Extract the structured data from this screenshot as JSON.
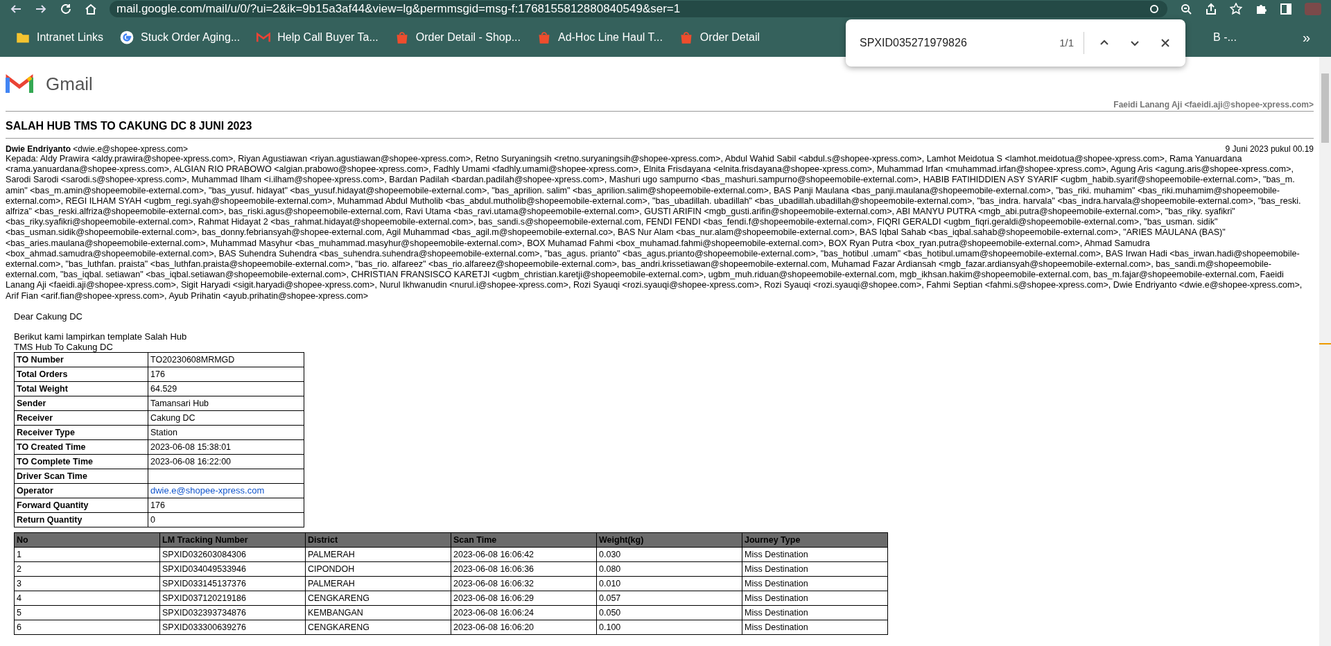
{
  "browser": {
    "url": "mail.google.com/mail/u/0/?ui=2&ik=9b15a3af44&view=lg&permmsgid=msg-f:1768155812880840549&ser=1",
    "bookmarks": [
      {
        "kind": "folder",
        "label": "Intranet Links"
      },
      {
        "kind": "google",
        "label": "Stuck Order Aging..."
      },
      {
        "kind": "gmail",
        "label": "Help Call Buyer Ta..."
      },
      {
        "kind": "shop",
        "label": "Order Detail - Shop..."
      },
      {
        "kind": "shop",
        "label": "Ad-Hoc Line Haul T..."
      },
      {
        "kind": "shop",
        "label": "Order Detail"
      },
      {
        "kind": "none",
        "label": "B -..."
      }
    ],
    "more": "»",
    "find_bar": {
      "query": "SPXID035271979826",
      "count": "1/1"
    }
  },
  "gmail": {
    "logo": "Gmail",
    "account": "Faeidi Lanang Aji <faeidi.aji@shopee-xpress.com>"
  },
  "email": {
    "subject": "SALAH HUB TMS TO CAKUNG DC 8 JUNI 2023",
    "sender_name": "Dwie Endriyanto",
    "sender_email": "<dwie.e@shopee-xpress.com>",
    "date": "9 Juni 2023 pukul 00.19",
    "recipients": "Kepada: Aldy Prawira <aldy.prawira@shopee-xpress.com>, Riyan Agustiawan <riyan.agustiawan@shopee-xpress.com>, Retno Suryaningsih <retno.suryaningsih@shopee-xpress.com>, Abdul Wahid Sabil <abdul.s@shopee-xpress.com>, Lamhot Meidotua S <lamhot.meidotua@shopee-xpress.com>, Rama Yanuardana <rama.yanuardana@shopee-xpress.com>, ALGIAN RIO PRABOWO <algian.prabowo@shopee-xpress.com>, Fadhly Umami <fadhly.umami@shopee-xpress.com>, Elnita Frisdayana <elnita.frisdayana@shopee-xpress.com>, Muhammad Irfan <muhammad.irfan@shopee-xpress.com>, Agung Aris <agung.aris@shopee-xpress.com>, Sarodi Sarodi <sarodi.s@shopee-xpress.com>, Muhammad Ilham <i.ilham@shopee-xpress.com>, Bardan Padilah <bardan.padilah@shopee-xpress.com>, Mashuri ugo sampurno <bas_mashuri.sampurno@shopeemobile-external.com>, HABIB FATIHIDDIEN ASY SYARIF <ugbm_habib.syarif@shopeemobile-external.com>, \"bas_m. amin\" <bas_m.amin@shopeemobile-external.com>, \"bas_yusuf. hidayat\" <bas_yusuf.hidayat@shopeemobile-external.com>, \"bas_aprilion. salim\" <bas_aprilion.salim@shopeemobile-external.com>, BAS Panji Maulana <bas_panji.maulana@shopeemobile-external.com>, \"bas_riki. muhamim\" <bas_riki.muhamim@shopeemobile-external.com>, REGI ILHAM SYAH <ugbm_regi.syah@shopeemobile-external.com>, Muhammad Abdul Mutholib <bas_abdul.mutholib@shopeemobile-external.com>, \"bas_ubadillah. ubadillah\" <bas_ubadillah.ubadillah@shopeemobile-external.com>, \"bas_indra. harvala\" <bas_indra.harvala@shopeemobile-external.com>, \"bas_reski. alfriza\" <bas_reski.alfriza@shopeemobile-external.com>, bas_riski.agus@shopeemobile-external.com, Ravi Utama <bas_ravi.utama@shopeemobile-external.com>, GUSTI ARIFIN <mgb_gusti.arifin@shopeemobile-external.com>, ABI MANYU PUTRA <mgb_abi.putra@shopeemobile-external.com>, \"bas_riky. syafikri\" <bas_riky.syafikri@shopeemobile-external.com>, Rahmat Hidayat 2 <bas_rahmat.hidayat@shopeemobile-external.com>, bas_sandi.s@shopeemobile-external.com, FENDI FENDI <bas_fendi.f@shopeemobile-external.com>, FIQRI GERALDI <ugbm_fiqri.geraldi@shopeemobile-external.com>, \"bas_usman. sidik\" <bas_usman.sidik@shopeemobile-external.com>, bas_donny.febriansyah@shopee-external.com, Agil Muhammad <bas_agil.m@shopeemobile-external.co>, BAS Nur Alam <bas_nur.alam@shopeemobile-external.com>, BAS Iqbal Sahab <bas_iqbal.sahab@shopeemobile-external.com>, \"ARIES MAULANA (BAS)\" <bas_aries.maulana@shopeemobile-external.com>, Muhammad Masyhur <bas_muhammad.masyhur@shopeemobile-external.com>, BOX Muhamad Fahmi <box_muhamad.fahmi@shopeemobile-external.com>, BOX Ryan Putra <box_ryan.putra@shopeemobile-external.com>, Ahmad Samudra <box_ahmad.samudra@shopeemobile-external.com>, BAS Suhendra Suhendra <bas_suhendra.suhendra@shopeemobile-external.com>, \"bas_agus. prianto\" <bas_agus.prianto@shopeemobile-external.com>, \"bas_hotibul .umam\" <bas_hotibul.umam@shopeemobile-external.com>, BAS Irwan Hadi <bas_irwan.hadi@shopeemobile-external.com>, \"bas_luthfan. praista\" <bas_luthfan.praista@shopeemobile-external.com>, \"bas_rio. alfareez\" <bas_rio.alfareez@shopeemobile-external.com>, bas_andri.krissetiawan@shopeemobile-external.com, Muhamad Fazar Ardiansah <mgb_fazar.ardiansyah@shopeemobile-external.com>, bas_sandi.m@shopeemobile-external.com, \"bas_iqbal. setiawan\" <bas_iqbal.setiawan@shopeemobile-external.com>, CHRISTIAN FRANSISCO KARETJI <ugbm_christian.karetji@shopeemobile-external.com>, ugbm_muh.riduan@shopeemobile-external.com, mgb_ikhsan.hakim@shopeemobile-external.com, bas_m.fajar@shopeemobile-external.com, Faeidi Lanang Aji <faeidi.aji@shopee-xpress.com>, Sigit Haryadi <sigit.haryadi@shopee-xpress.com>, Nurul Ikhwanudin <nurul.i@shopee-xpress.com>, Rozi Syauqi <rozi.syauqi@shopee-xpress.com>, Rozi Syauqi <rozi.syauqi@shopee.com>, Fahmi Septian <fahmi.s@shopee-xpress.com>, Dwie Endriyanto <dwie.e@shopee-xpress.com>, Arif Fian <arif.fian@shopee-xpress.com>, Ayub Prihatin <ayub.prihatin@shopee-xpress.com>",
    "greeting": "Dear Cakung DC",
    "body_lines": [
      "Berikut kami lampirkan template Salah Hub",
      "TMS Hub To Cakung DC"
    ],
    "summary": [
      {
        "label": "TO Number",
        "value": "TO20230608MRMGD",
        "kind": "text"
      },
      {
        "label": "Total Orders",
        "value": "176",
        "kind": "text"
      },
      {
        "label": "Total Weight",
        "value": "64.529",
        "kind": "text"
      },
      {
        "label": "Sender",
        "value": "Tamansari Hub",
        "kind": "text"
      },
      {
        "label": "Receiver",
        "value": "Cakung DC",
        "kind": "text"
      },
      {
        "label": "Receiver Type",
        "value": "Station",
        "kind": "text"
      },
      {
        "label": "TO Created Time",
        "value": "2023-06-08 15:38:01",
        "kind": "text"
      },
      {
        "label": "TO Complete Time",
        "value": "2023-06-08 16:22:00",
        "kind": "text"
      },
      {
        "label": "Driver Scan Time",
        "kind": "text"
      },
      {
        "label": "Operator",
        "value": "dwie.e@shopee-xpress.com",
        "kind": "link"
      },
      {
        "label": "Forward Quantity",
        "value": "176",
        "kind": "text"
      },
      {
        "label": "Return Quantity",
        "value": "0",
        "kind": "text"
      }
    ],
    "tracking_table": {
      "columns": [
        "No",
        "LM Tracking Number",
        "District",
        "Scan Time",
        "Weight(kg)",
        "Journey Type"
      ],
      "rows": [
        [
          "1",
          "SPXID032603084306",
          "PALMERAH",
          "2023-06-08 16:06:42",
          "0.030",
          "Miss Destination"
        ],
        [
          "2",
          "SPXID034049533946",
          "CIPONDOH",
          "2023-06-08 16:06:36",
          "0.080",
          "Miss Destination"
        ],
        [
          "3",
          "SPXID033145137376",
          "PALMERAH",
          "2023-06-08 16:06:32",
          "0.010",
          "Miss Destination"
        ],
        [
          "4",
          "SPXID037120219186",
          "CENGKARENG",
          "2023-06-08 16:06:29",
          "0.057",
          "Miss Destination"
        ],
        [
          "5",
          "SPXID032393734876",
          "KEMBANGAN",
          "2023-06-08 16:06:24",
          "0.050",
          "Miss Destination"
        ],
        [
          "6",
          "SPXID033300639276",
          "CENGKARENG",
          "2023-06-08 16:06:20",
          "0.100",
          "Miss Destination"
        ]
      ]
    }
  }
}
